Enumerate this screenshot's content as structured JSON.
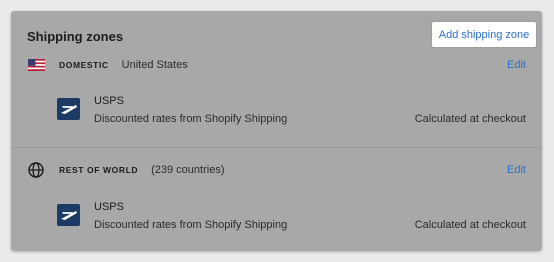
{
  "header": {
    "title": "Shipping zones",
    "add_button_label": "Add shipping zone"
  },
  "zones": [
    {
      "name": "DOMESTIC",
      "meta": "United States",
      "edit_label": "Edit",
      "icon": "us-flag-icon",
      "rate": {
        "carrier": "USPS",
        "description": "Discounted rates from Shopify Shipping",
        "price": "Calculated at checkout"
      }
    },
    {
      "name": "REST OF WORLD",
      "meta": "(239 countries)",
      "edit_label": "Edit",
      "icon": "globe-icon",
      "rate": {
        "carrier": "USPS",
        "description": "Discounted rates from Shopify Shipping",
        "price": "Calculated at checkout"
      }
    }
  ],
  "colors": {
    "link": "#2c6ecb",
    "usps_logo": "#1b3a64",
    "overlay": "#a8a8a8"
  }
}
